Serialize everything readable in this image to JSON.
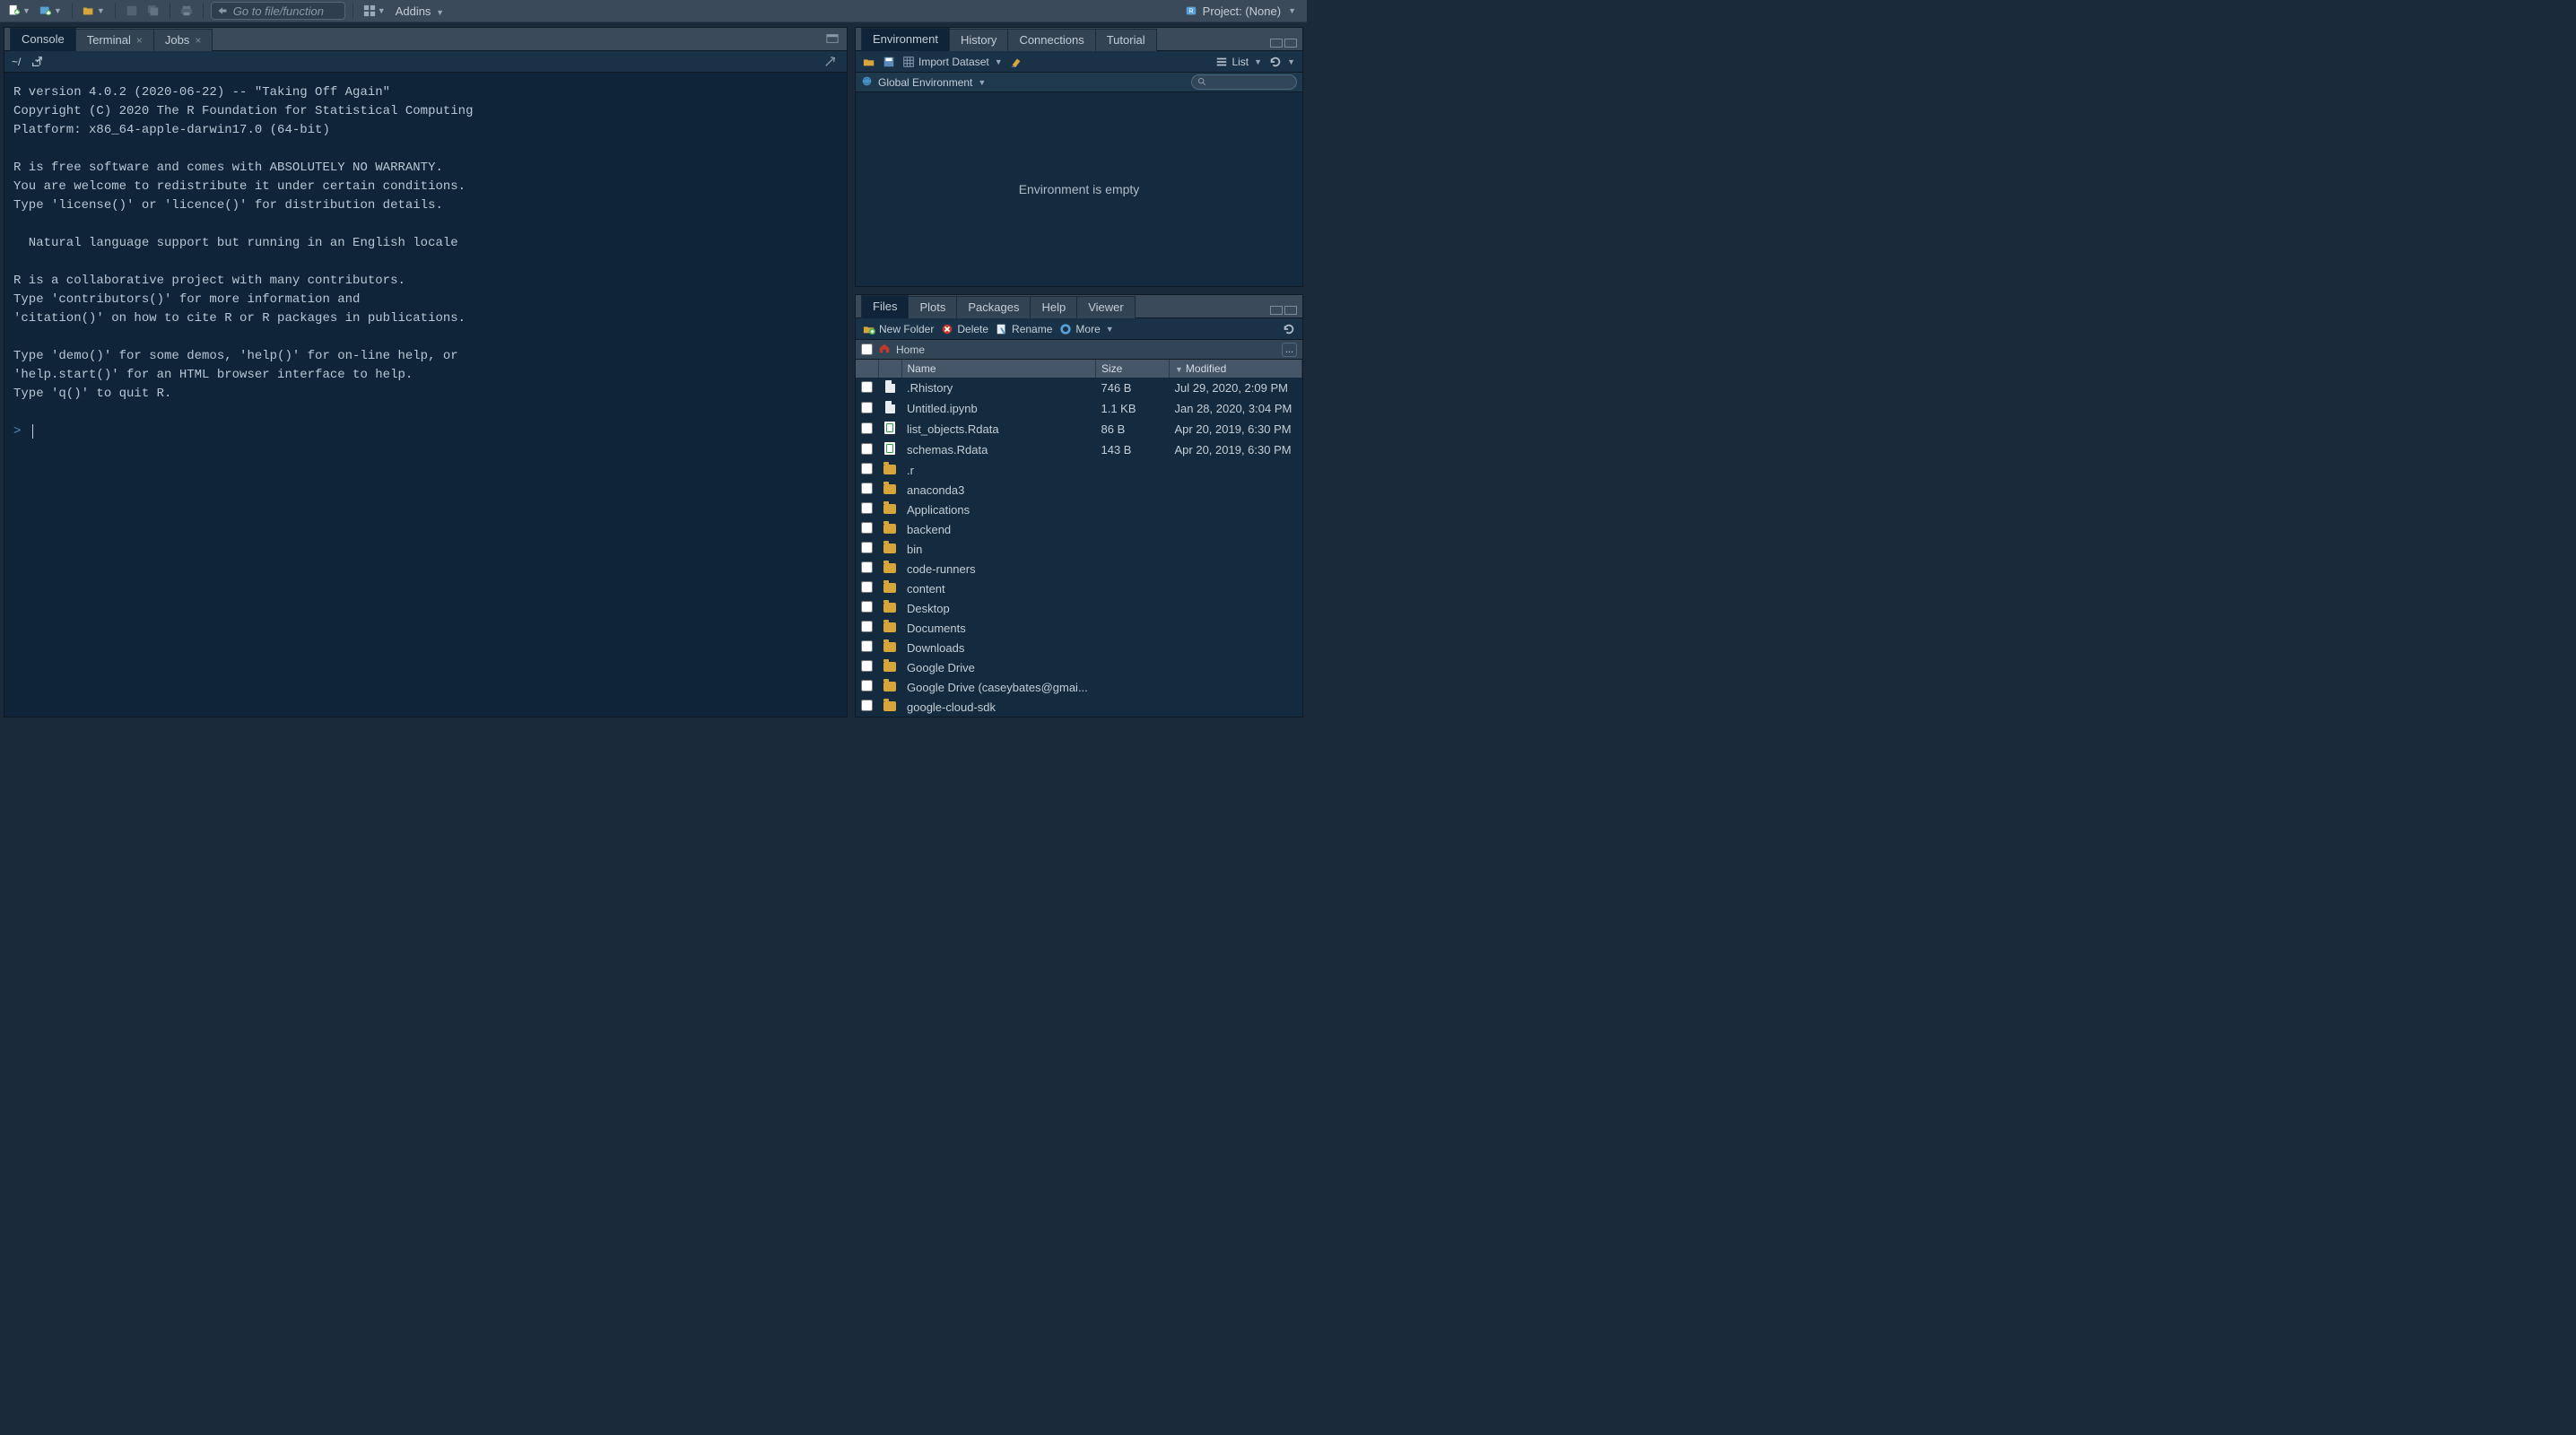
{
  "toolbar": {
    "goto_placeholder": "Go to file/function",
    "addins_label": "Addins",
    "project_label": "Project: (None)"
  },
  "console": {
    "tabs": [
      "Console",
      "Terminal",
      "Jobs"
    ],
    "path": "~/",
    "text": "R version 4.0.2 (2020-06-22) -- \"Taking Off Again\"\nCopyright (C) 2020 The R Foundation for Statistical Computing\nPlatform: x86_64-apple-darwin17.0 (64-bit)\n\nR is free software and comes with ABSOLUTELY NO WARRANTY.\nYou are welcome to redistribute it under certain conditions.\nType 'license()' or 'licence()' for distribution details.\n\n  Natural language support but running in an English locale\n\nR is a collaborative project with many contributors.\nType 'contributors()' for more information and\n'citation()' on how to cite R or R packages in publications.\n\nType 'demo()' for some demos, 'help()' for on-line help, or\n'help.start()' for an HTML browser interface to help.\nType 'q()' to quit R.\n",
    "prompt": ">"
  },
  "env": {
    "tabs": [
      "Environment",
      "History",
      "Connections",
      "Tutorial"
    ],
    "import_label": "Import Dataset",
    "list_label": "List",
    "scope_label": "Global Environment",
    "empty_text": "Environment is empty"
  },
  "files": {
    "tabs": [
      "Files",
      "Plots",
      "Packages",
      "Help",
      "Viewer"
    ],
    "new_folder": "New Folder",
    "delete": "Delete",
    "rename": "Rename",
    "more": "More",
    "breadcrumb": "Home",
    "columns": {
      "name": "Name",
      "size": "Size",
      "modified": "Modified"
    },
    "rows": [
      {
        "icon": "file",
        "name": ".Rhistory",
        "size": "746 B",
        "modified": "Jul 29, 2020, 2:09 PM"
      },
      {
        "icon": "file",
        "name": "Untitled.ipynb",
        "size": "1.1 KB",
        "modified": "Jan 28, 2020, 3:04 PM"
      },
      {
        "icon": "rdata",
        "name": "list_objects.Rdata",
        "size": "86 B",
        "modified": "Apr 20, 2019, 6:30 PM"
      },
      {
        "icon": "rdata",
        "name": "schemas.Rdata",
        "size": "143 B",
        "modified": "Apr 20, 2019, 6:30 PM"
      },
      {
        "icon": "folder",
        "name": ".r",
        "size": "",
        "modified": ""
      },
      {
        "icon": "folder",
        "name": "anaconda3",
        "size": "",
        "modified": ""
      },
      {
        "icon": "folder",
        "name": "Applications",
        "size": "",
        "modified": ""
      },
      {
        "icon": "folder",
        "name": "backend",
        "size": "",
        "modified": ""
      },
      {
        "icon": "folder",
        "name": "bin",
        "size": "",
        "modified": ""
      },
      {
        "icon": "folder",
        "name": "code-runners",
        "size": "",
        "modified": ""
      },
      {
        "icon": "folder",
        "name": "content",
        "size": "",
        "modified": ""
      },
      {
        "icon": "folder",
        "name": "Desktop",
        "size": "",
        "modified": ""
      },
      {
        "icon": "folder",
        "name": "Documents",
        "size": "",
        "modified": ""
      },
      {
        "icon": "folder",
        "name": "Downloads",
        "size": "",
        "modified": ""
      },
      {
        "icon": "folder",
        "name": "Google Drive",
        "size": "",
        "modified": ""
      },
      {
        "icon": "folder",
        "name": "Google Drive (caseybates@gmai...",
        "size": "",
        "modified": ""
      },
      {
        "icon": "folder",
        "name": "google-cloud-sdk",
        "size": "",
        "modified": ""
      }
    ]
  }
}
